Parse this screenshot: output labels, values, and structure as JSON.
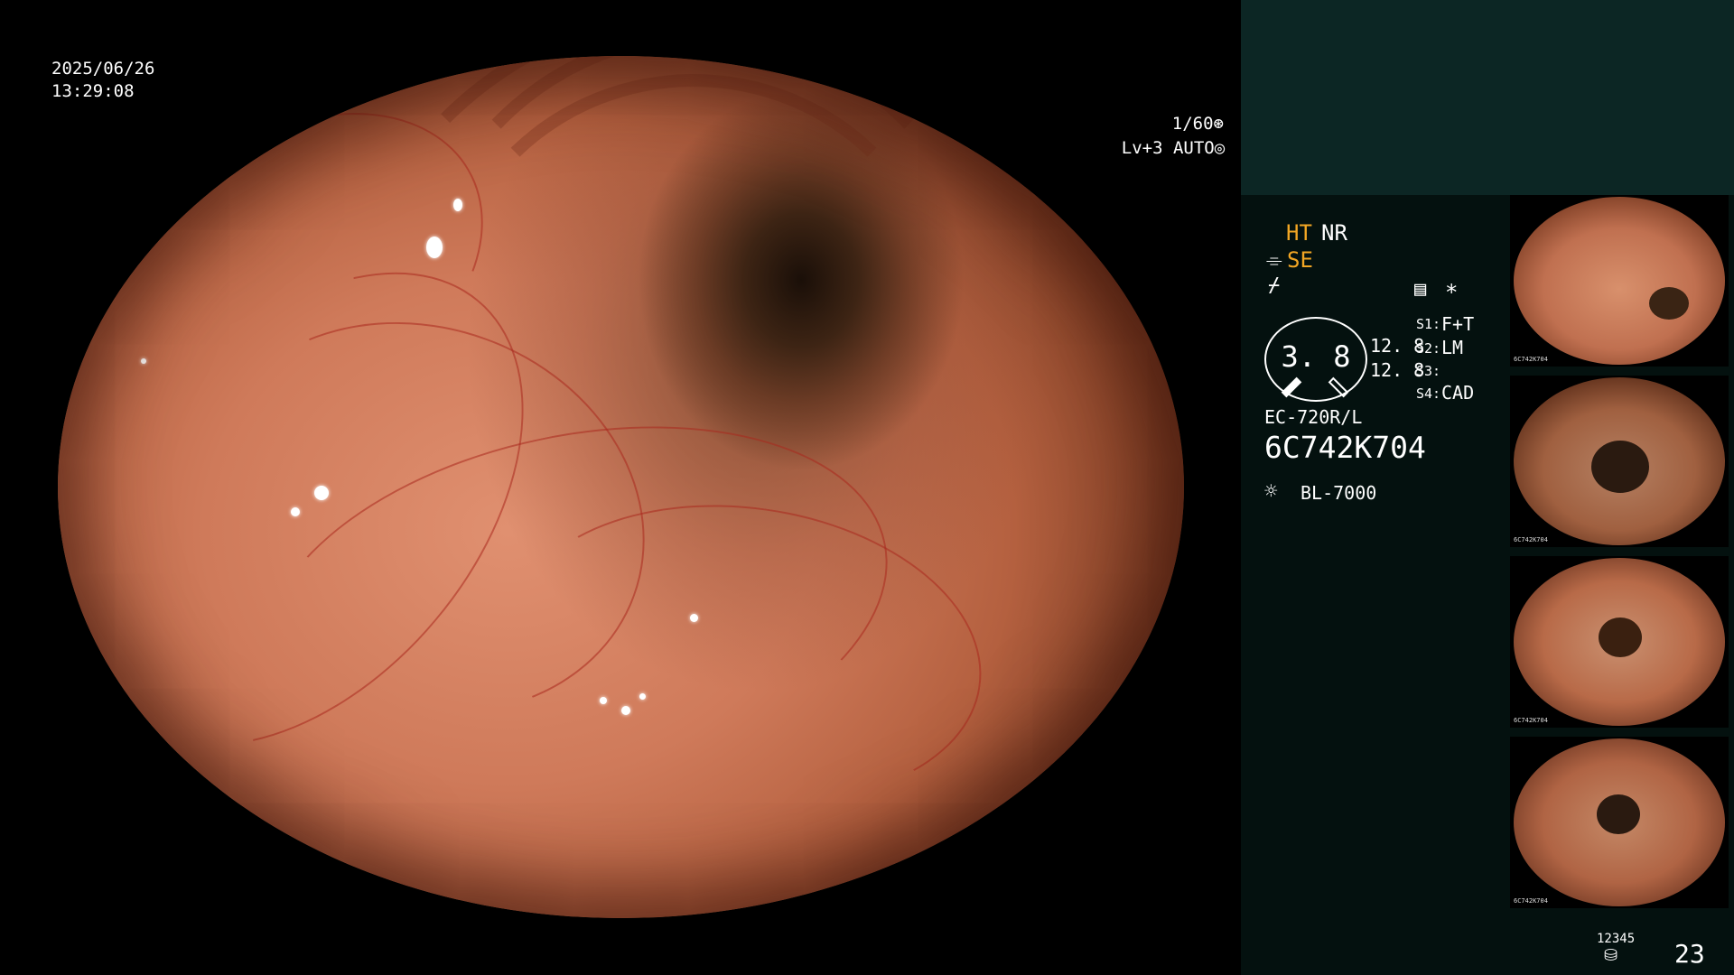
{
  "overlay": {
    "date": "2025/06/26",
    "time": "13:29:08",
    "shutter": "1/60",
    "shutter_icon": "shutter-icon",
    "brightness": "Lv+3 AUTO",
    "brightness_icon": "iris-icon"
  },
  "status": {
    "ht": "HT",
    "nr": "NR",
    "se_icon": "pump-icon",
    "se": "SE",
    "f_icon": "freeze-icon",
    "memo_icon": "document-icon",
    "star": "*",
    "colors": {
      "highlight": "#f2a624",
      "panel": "#04110f",
      "panel_top": "#0c2624"
    }
  },
  "gauge": {
    "value": "3. 8",
    "val1": "12. 8",
    "val2": "12. 8"
  },
  "switches": [
    {
      "key": "S1:",
      "value": "F+T"
    },
    {
      "key": "S2:",
      "value": "LM"
    },
    {
      "key": "S3:",
      "value": ""
    },
    {
      "key": "S4:",
      "value": "CAD"
    }
  ],
  "scope": {
    "model": "EC-720R/L",
    "serial": "6C742K704",
    "light_icon": "light-source-icon",
    "light_source": "BL-7000"
  },
  "thumbnails": [
    {
      "caption": "6C742K704"
    },
    {
      "caption": "6C742K704"
    },
    {
      "caption": "6C742K704"
    },
    {
      "caption": "6C742K704"
    }
  ],
  "footer": {
    "storage_label": "12345",
    "storage_icon": "database-icon",
    "count": "23"
  }
}
